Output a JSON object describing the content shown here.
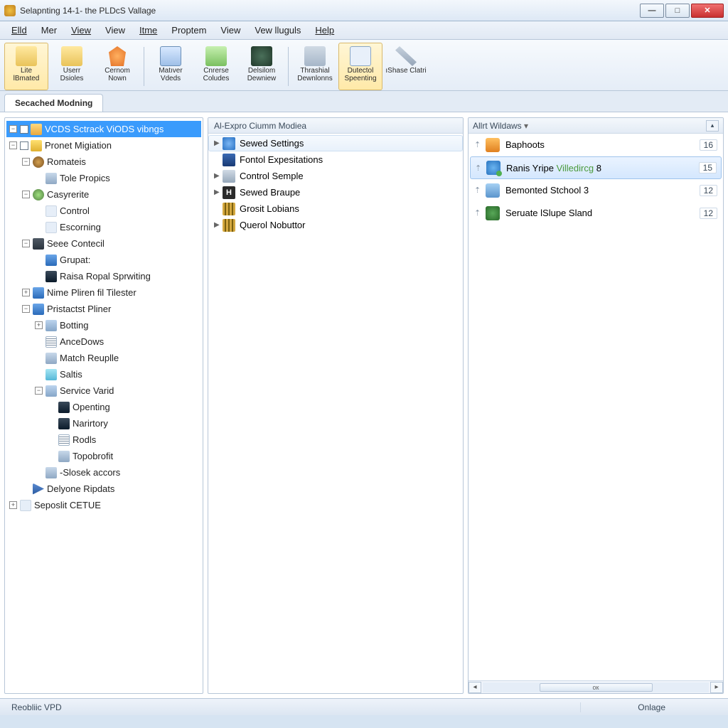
{
  "window": {
    "title": "Selapnting 14-1- the PLDcS Vallage"
  },
  "menu": {
    "items": [
      "Elld",
      "Mer",
      "View",
      "View",
      "Itme",
      "Proptem",
      "View",
      "Vew lluguls",
      "Help"
    ]
  },
  "toolbar": {
    "buttons": [
      {
        "line1": "Lite",
        "line2": "lBmated",
        "icon": "ic-folder",
        "active": true
      },
      {
        "line1": "Userr",
        "line2": "Dsioles",
        "icon": "ic-folder2"
      },
      {
        "line1": "Cernom",
        "line2": "Nown",
        "icon": "ic-person"
      },
      {
        "line1": "Matıver",
        "line2": "Vdeds",
        "icon": "ic-doc"
      },
      {
        "line1": "Cnrerse",
        "line2": "Coludes",
        "icon": "ic-green"
      },
      {
        "line1": "Delsilom",
        "line2": "Dewniew",
        "icon": "ic-globe"
      },
      {
        "line1": "Thrashial",
        "line2": "Dewnlonns",
        "icon": "ic-key"
      },
      {
        "line1": "Dutectol",
        "line2": "Speenting",
        "icon": "ic-page",
        "active": true
      },
      {
        "line1": "ıShase Clatri",
        "line2": "",
        "icon": "ic-wrench"
      }
    ]
  },
  "tabs": {
    "active": "Secached Modning"
  },
  "tree": {
    "rows": [
      {
        "depth": 0,
        "exp": "-",
        "chk": true,
        "icon": "ni-root",
        "label": "VCDS Sctrack ViODS vibngs",
        "sel": true
      },
      {
        "depth": 0,
        "exp": "-",
        "chk": true,
        "icon": "ni-pencil",
        "label": "Pronet Migiation"
      },
      {
        "depth": 1,
        "exp": "-",
        "icon": "ni-ball",
        "label": "Romateis"
      },
      {
        "depth": 2,
        "icon": "ni-card",
        "label": "Tole Propics"
      },
      {
        "depth": 1,
        "exp": "-",
        "icon": "ni-gg",
        "label": "Casyrerite"
      },
      {
        "depth": 2,
        "icon": "ni-blank",
        "label": "Control"
      },
      {
        "depth": 2,
        "icon": "ni-blank",
        "label": "Escorning"
      },
      {
        "depth": 1,
        "exp": "-",
        "icon": "ni-dark",
        "label": "Seee Contecil"
      },
      {
        "depth": 2,
        "icon": "ni-blue",
        "label": "Grupat:"
      },
      {
        "depth": 2,
        "icon": "ni-mon",
        "label": "Raisa Ropal Sprwiting"
      },
      {
        "depth": 1,
        "exp": "+",
        "icon": "ni-blue",
        "label": "Nime Pliren fil Tilester"
      },
      {
        "depth": 1,
        "exp": "-",
        "icon": "ni-blue",
        "label": "Pristactst Pliner"
      },
      {
        "depth": 2,
        "exp": "+",
        "icon": "ni-pic",
        "label": "Botting"
      },
      {
        "depth": 2,
        "icon": "ni-list",
        "label": "AnceDows"
      },
      {
        "depth": 2,
        "icon": "ni-card",
        "label": "Match Reuplle"
      },
      {
        "depth": 2,
        "icon": "ni-cyan",
        "label": "Saltis"
      },
      {
        "depth": 2,
        "exp": "-",
        "icon": "ni-pic",
        "label": "Service Varid"
      },
      {
        "depth": 3,
        "icon": "ni-mon",
        "label": "Openting"
      },
      {
        "depth": 3,
        "icon": "ni-mon",
        "label": "Narirtory"
      },
      {
        "depth": 3,
        "icon": "ni-list",
        "label": "Rodls"
      },
      {
        "depth": 3,
        "icon": "ni-card",
        "label": "Topobrofit"
      },
      {
        "depth": 2,
        "icon": "ni-card",
        "label": "-Slosek accors"
      },
      {
        "depth": 1,
        "icon": "ni-play",
        "label": "Delyone Ripdats"
      },
      {
        "depth": 0,
        "exp": "+",
        "icon": "ni-blank",
        "label": "Seposlit CETUE"
      }
    ]
  },
  "middle": {
    "header": "Al-Expro Ciumm Modiea",
    "rows": [
      {
        "arrow": true,
        "icon": "mi-pin",
        "label": "Sewed Settings",
        "hover": true
      },
      {
        "arrow": false,
        "icon": "mi-card",
        "label": "Fontol Expesitations"
      },
      {
        "arrow": true,
        "icon": "mi-z",
        "label": "Control Semple"
      },
      {
        "arrow": true,
        "icon": "mi-h",
        "glyph": "H",
        "label": "Sewed Braupe"
      },
      {
        "arrow": false,
        "icon": "mi-bars",
        "label": "Grosit Lobians"
      },
      {
        "arrow": true,
        "icon": "mi-bars",
        "label": "Querol Nobuttor"
      }
    ]
  },
  "right": {
    "header": "Allrt Wildaws",
    "rows": [
      {
        "icon": "ri-1",
        "label": "Baphoots",
        "count": "16"
      },
      {
        "icon": "ri-2",
        "label_pre": "Ranis Yripe ",
        "label_green": "Villedircg",
        "label_post": " 8",
        "count": "15",
        "sel": true
      },
      {
        "icon": "ri-3",
        "label": "Bemonted Stchool 3",
        "count": "12"
      },
      {
        "icon": "ri-4",
        "label": "Seruate lSlupe Sland",
        "count": "12"
      }
    ],
    "scroll_thumb": "ок"
  },
  "status": {
    "left": "Reobliic VPD",
    "right": "Onlage"
  }
}
